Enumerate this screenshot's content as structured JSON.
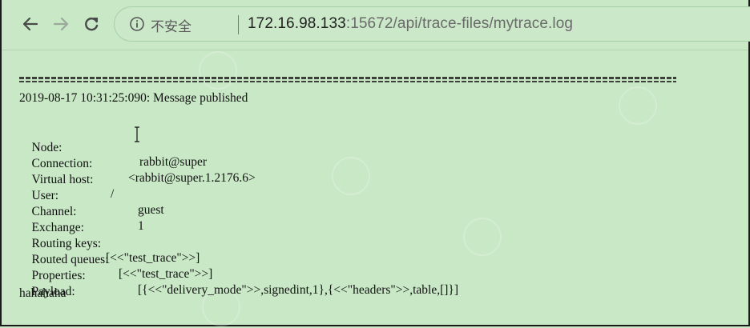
{
  "browser": {
    "security_label": "不安全",
    "url_host": "172.16.98.133",
    "url_rest": ":15672/api/trace-files/mytrace.log",
    "icons": {
      "back": "back-arrow-icon",
      "forward": "forward-arrow-icon",
      "reload": "reload-icon",
      "info": "info-icon"
    }
  },
  "trace": {
    "header": "2019-08-17 10:31:25:090: Message published",
    "fields": [
      {
        "key": "Node:",
        "value": "rabbit@super"
      },
      {
        "key": "Connection:",
        "value": "<rabbit@super.1.2176.6>"
      },
      {
        "key": "Virtual host:",
        "value": "/"
      },
      {
        "key": "User:",
        "value": "guest"
      },
      {
        "key": "Channel:",
        "value": "1"
      },
      {
        "key": "Exchange:",
        "value": ""
      },
      {
        "key": "Routing keys:",
        "value": "[<<\"test_trace\">>]"
      },
      {
        "key": "Routed queues:",
        "value": "[<<\"test_trace\">>]"
      },
      {
        "key": "Properties:",
        "value": "[{<<\"delivery_mode\">>,signedint,1},{<<\"headers\">>,table,[]}]"
      },
      {
        "key": "Payload:",
        "value": ""
      }
    ],
    "payload": "hahahaha"
  },
  "colors": {
    "background": "#c8e8c6",
    "url_host": "#202020",
    "url_rest": "#6a6a6a"
  }
}
